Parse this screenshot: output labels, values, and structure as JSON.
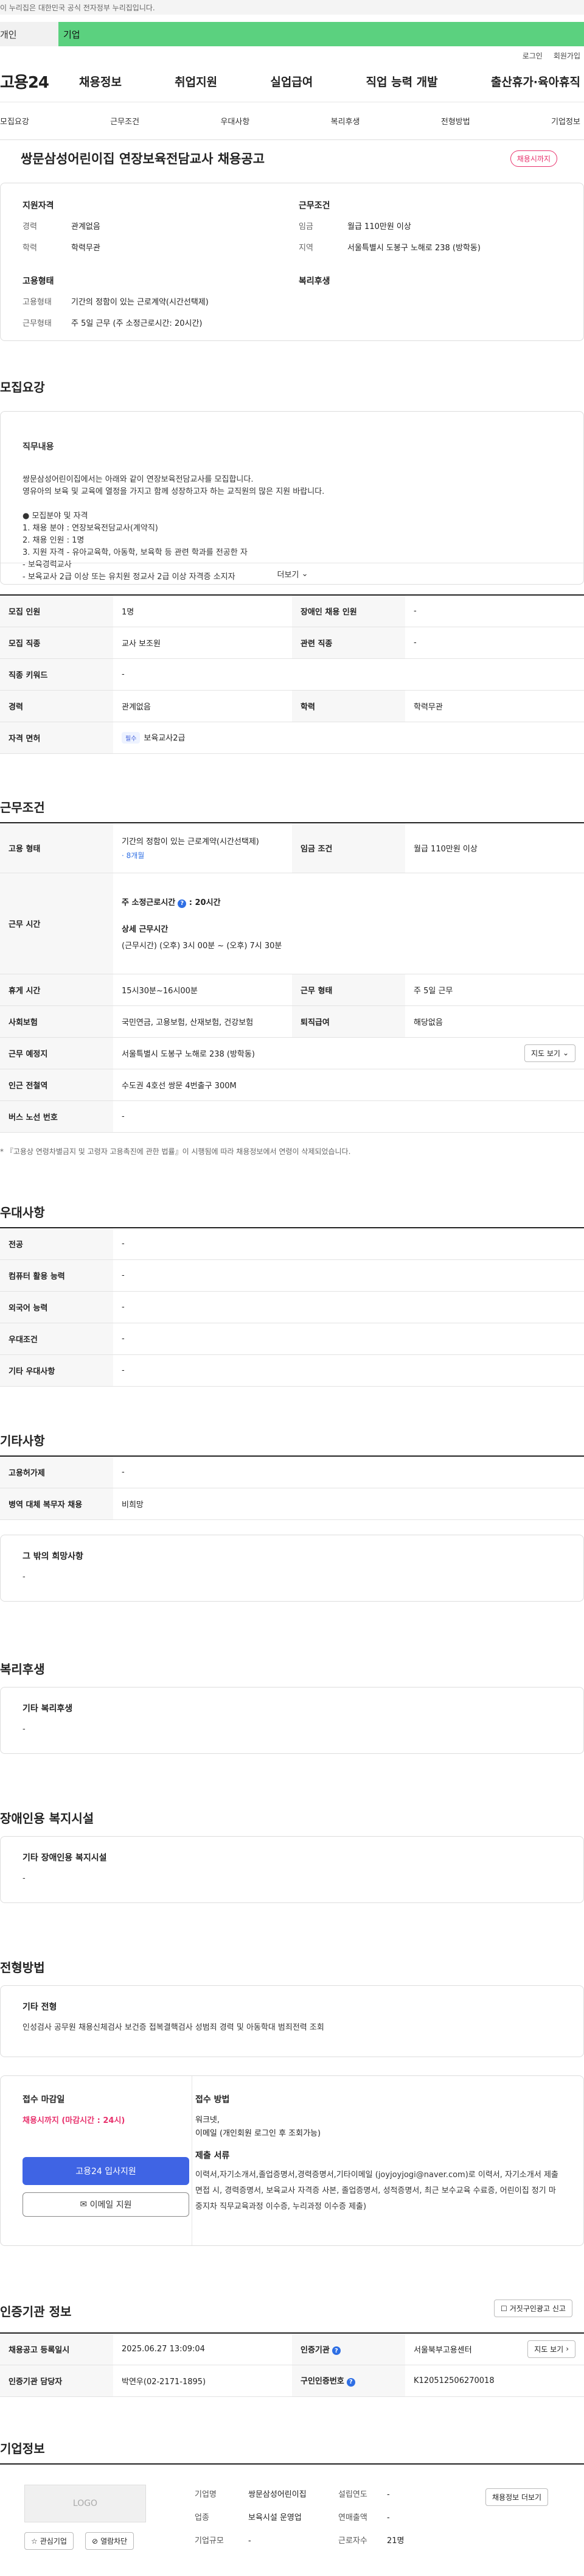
{
  "gov_bar": {
    "text": "이 누리집은 대한민국 공식 전자정부 누리집입니다."
  },
  "type_tabs": [
    {
      "label": "개인"
    },
    {
      "label": "기업"
    }
  ],
  "util_links": [
    {
      "label": "로그인"
    },
    {
      "label": "회원가입"
    }
  ],
  "gnb": {
    "logo": "고용24",
    "menus": [
      "채용정보",
      "취업지원",
      "실업급여",
      "직업 능력 개발",
      "출산휴가·육아휴직"
    ]
  },
  "subnav": [
    "모집요강",
    "근무조건",
    "우대사항",
    "복리후생",
    "전형방법",
    "기업정보"
  ],
  "header": {
    "title": "쌍문삼성어린이집 연장보육전담교사 채용공고",
    "badge": "채용시까지"
  },
  "summary": {
    "left_title": "지원자격",
    "left": [
      {
        "k": "경력",
        "v": "관계없음"
      },
      {
        "k": "학력",
        "v": "학력무관"
      }
    ],
    "left2_title": "고용형태",
    "left2": [
      {
        "k": "고용형태",
        "v": "기간의 정함이 있는 근로계약(시간선택제)"
      },
      {
        "k": "근무형태",
        "v": "주 5일 근무 (주 소정근로시간: 20시간)"
      }
    ],
    "right_title": "근무조건",
    "right": [
      {
        "k": "임금",
        "v": "월급 110만원 이상"
      },
      {
        "k": "지역",
        "v": "서울특별시 도봉구 노해로 238 (방학동)"
      }
    ],
    "right2_title": "복리후생"
  },
  "recruit": {
    "title": "모집요강",
    "box_title": "직무내용",
    "body": "쌍문삼성어린이집에서는 아래와 같이 연장보육전담교사를 모집합니다.\n영유아의 보육 및 교육에 열정을 가지고 함께 성장하고자 하는 교직원의 많은 지원 바랍니다.\n\n● 모집분야 및 자격\n1. 채용 분야 : 연장보육전담교사(계약직)\n2. 채용 인원 : 1명\n3. 지원 자격  - 유아교육학, 아동학, 보육학 등 관련 학과를 전공한 자\n                   - 보육경력교사\n                   - 보육교사 2급 이상 또는 유치원 정교사 2급 이상 자격증 소지자",
    "more": "더보기"
  },
  "recruit_table": [
    [
      {
        "k": "모집 인원",
        "v": "1명"
      },
      {
        "k": "장애인 채용 인원",
        "v": "-"
      }
    ],
    [
      {
        "k": "모집 직종",
        "v": "교사 보조원"
      },
      {
        "k": "관련 직종",
        "v": "-"
      }
    ],
    [
      {
        "k": "직종 키워드",
        "v": "-"
      }
    ],
    [
      {
        "k": "경력",
        "v": "관계없음"
      },
      {
        "k": "학력",
        "v": "학력무관"
      }
    ],
    [
      {
        "k": "자격 면허",
        "chip": "필수",
        "v": "보육교사2급"
      }
    ]
  ],
  "work": {
    "title": "근무조건",
    "employ_k": "고용 형태",
    "employ_v": "기간의 정함이 있는 근로계약(시간선택제)",
    "employ_sub": "· 8개월",
    "wage_k": "임금 조건",
    "wage_v": "월급 110만원 이상",
    "hours_k": "근무 시간",
    "hours_1": "주 소정근로시간",
    "hours_1v": "20시간",
    "hours_2": "상세 근무시간",
    "hours_2v": "(근무시간) (오후) 3시 00분 ~ (오후) 7시 30분",
    "rows": [
      [
        {
          "k": "휴게 시간",
          "v": "15시30분~16시00분"
        },
        {
          "k": "근무 형태",
          "v": "주 5일 근무"
        }
      ],
      [
        {
          "k": "사회보험",
          "v": "국민연금, 고용보험, 산재보험, 건강보험"
        },
        {
          "k": "퇴직급여",
          "v": "해당없음"
        }
      ]
    ],
    "addr_k": "근무 예정지",
    "addr_v": "서울특별시 도봉구 노해로 238 (방학동)",
    "map_btn": "지도 보기",
    "subway_k": "인근 전철역",
    "subway_v": "수도권 4호선 쌍문 4번출구 300M",
    "bus_k": "버스 노선 번호",
    "bus_v": "-",
    "note": "* 『고용상 연령차별금지 및 고령자 고용촉진에 관한 법률』이 시행됨에 따라 채용정보에서 연령이 삭제되었습니다."
  },
  "prefer": {
    "title": "우대사항",
    "rows": [
      {
        "k": "전공",
        "v": "-"
      },
      {
        "k": "컴퓨터 활용 능력",
        "v": "-"
      },
      {
        "k": "외국어 능력",
        "v": "-"
      },
      {
        "k": "우대조건",
        "v": "-"
      },
      {
        "k": "기타 우대사항",
        "v": "-"
      }
    ]
  },
  "etc": {
    "title": "기타사항",
    "rows": [
      {
        "k": "고용허가제",
        "v": "-"
      },
      {
        "k": "병역 대체 복무자 채용",
        "v": "비희망"
      }
    ],
    "box_title": "그 밖의 희망사항",
    "box_v": "-"
  },
  "welfare": {
    "title": "복리후생",
    "box_title": "기타 복리후생",
    "box_v": "-"
  },
  "disabled": {
    "title": "장애인용 복지시설",
    "box_title": "기타 장애인용 복지시설",
    "box_v": "-"
  },
  "process": {
    "title": "전형방법",
    "box_title": "기타 전형",
    "box_v": "인성검사 공무원 채용신체검사 보건증 접복결핵검사 성범죄 경력 및 아동학대 범죄전력 조회",
    "deadline_title": "접수 마감일",
    "deadline_v": "채용시까지 (마감시간 : 24시)",
    "apply_btn": "고용24 입사지원",
    "email_btn": "이메일 지원",
    "method_title": "접수 방법",
    "method_v1": "워크넷,",
    "method_v2": "이메일 (개인회원 로그인 후 조회가능)",
    "docs_title": "제출 서류",
    "docs_v": "이력서,자기소개서,졸업증명서,경력증명서,기타이메일 (joyjoyjogi@naver.com)로 이력서, 자기소개서 제출 면접 시, 경력증명서, 보육교사 자격증 사본, 졸업증명서, 성적증명서, 최근 보수교육 수료증, 어린이집 정기 마중지차 직무교육과정 이수증, 누리과정 이수증 제출)"
  },
  "agency": {
    "title": "인증기관 정보",
    "report_btn": "거짓구인광고 신고",
    "reg_k": "채용공고 등록일시",
    "reg_v": "2025.06.27 13:09:04",
    "org_k": "인증기관",
    "org_v": "서울북부고용센터",
    "map_btn": "지도 보기",
    "mgr_k": "인증기관 담당자",
    "mgr_v": "박연우(02-2171-1895)",
    "num_k": "구인인증번호",
    "num_v": "K120512506270018"
  },
  "company": {
    "title": "기업정보",
    "logo": "LOGO",
    "fav_btn": "관심기업",
    "block_btn": "열람차단",
    "name_k": "기업명",
    "name_v": "쌍문삼성어린이집",
    "found_k": "설립연도",
    "found_v": "-",
    "ind_k": "업종",
    "ind_v": "보육시설 운영업",
    "sales_k": "연매출액",
    "sales_v": "-",
    "size_k": "기업규모",
    "size_v": "-",
    "emp_k": "근로자수",
    "emp_v": "21명",
    "jobs_btn": "채용정보 더보기"
  }
}
